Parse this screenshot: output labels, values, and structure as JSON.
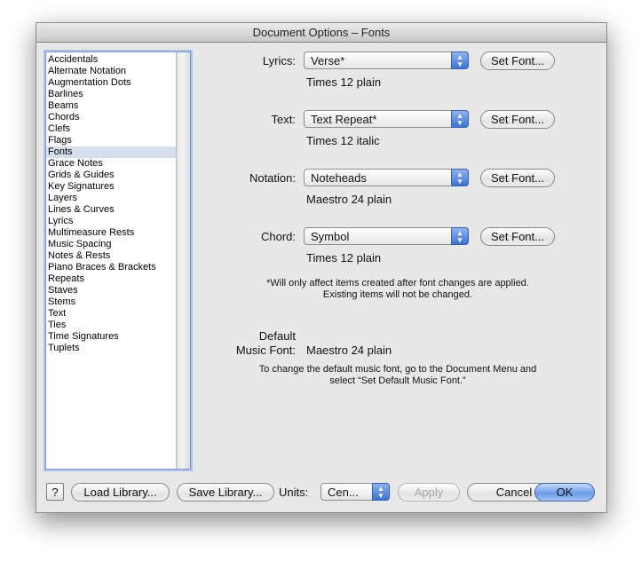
{
  "window": {
    "title": "Document Options – Fonts"
  },
  "sidebar": {
    "items": [
      "Accidentals",
      "Alternate Notation",
      "Augmentation Dots",
      "Barlines",
      "Beams",
      "Chords",
      "Clefs",
      "Flags",
      "Fonts",
      "Grace Notes",
      "Grids & Guides",
      "Key Signatures",
      "Layers",
      "Lines & Curves",
      "Lyrics",
      "Multimeasure Rests",
      "Music Spacing",
      "Notes & Rests",
      "Piano Braces & Brackets",
      "Repeats",
      "Staves",
      "Stems",
      "Text",
      "Ties",
      "Time Signatures",
      "Tuplets"
    ],
    "selected": "Fonts"
  },
  "fonts": {
    "lyrics": {
      "label": "Lyrics:",
      "value": "Verse*",
      "desc": "Times 12 plain"
    },
    "text": {
      "label": "Text:",
      "value": "Text Repeat*",
      "desc": "Times 12 italic"
    },
    "notation": {
      "label": "Notation:",
      "value": "Noteheads",
      "desc": "Maestro 24 plain"
    },
    "chord": {
      "label": "Chord:",
      "value": "Symbol",
      "desc": "Times 12 plain"
    },
    "set_font_label": "Set Font..."
  },
  "note": {
    "line1": "*Will only affect items created after font changes are applied.",
    "line2": "Existing items will not be changed."
  },
  "default_music_font": {
    "label_line1": "Default",
    "label_line2": "Music Font:",
    "value": "Maestro 24 plain",
    "info_line1": "To change the default music font, go to the Document Menu and",
    "info_line2": "select “Set Default Music Font.”"
  },
  "footer": {
    "help": "?",
    "load_library": "Load Library...",
    "save_library": "Save Library...",
    "units_label": "Units:",
    "units_value": "Cen...",
    "apply": "Apply",
    "cancel": "Cancel",
    "ok": "OK"
  }
}
